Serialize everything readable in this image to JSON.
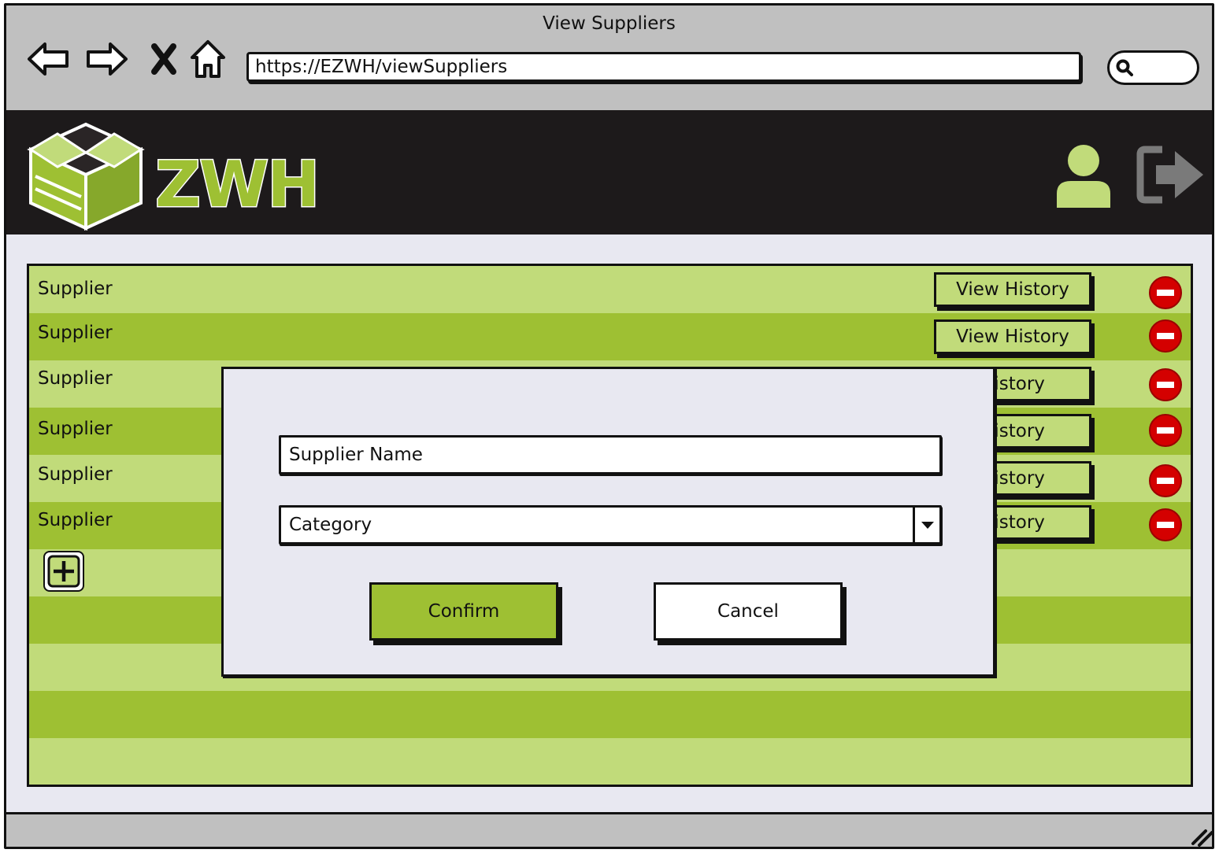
{
  "window": {
    "title": "View Suppliers"
  },
  "browser": {
    "url": "https://EZWH/viewSuppliers",
    "nav_icons": [
      "back-arrow-icon",
      "forward-arrow-icon",
      "close-x-icon",
      "home-icon"
    ],
    "search_icon": "magnifier-icon"
  },
  "header": {
    "logo_text": "ZWH",
    "user_icon": "user-icon",
    "logout_icon": "logout-icon"
  },
  "suppliers": {
    "rows": [
      {
        "label": "Supplier",
        "history_label": "View History"
      },
      {
        "label": "Supplier",
        "history_label": "View History"
      },
      {
        "label": "Supplier",
        "history_label": "History"
      },
      {
        "label": "Supplier",
        "history_label": "History"
      },
      {
        "label": "Supplier",
        "history_label": "History"
      },
      {
        "label": "Supplier",
        "history_label": "History"
      }
    ],
    "add_icon": "plus-icon",
    "delete_icon": "minus-circle-icon"
  },
  "modal": {
    "name_field": "Supplier Name",
    "category_select": "Category",
    "confirm_label": "Confirm",
    "cancel_label": "Cancel"
  },
  "colors": {
    "accent_green": "#9ec033",
    "light_green": "#c1db7a",
    "header_bg": "#1d1a1b",
    "delete_red": "#d40000",
    "chrome_gray": "#c0c0c0"
  }
}
